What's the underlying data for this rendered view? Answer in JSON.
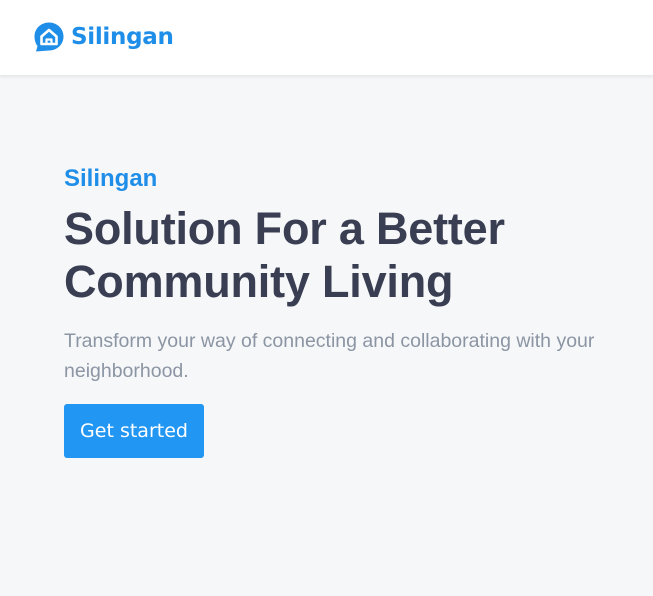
{
  "brand": {
    "name": "Silingan",
    "icon": "house-chat-bubble-icon",
    "color": "#1f8ee8"
  },
  "hero": {
    "eyebrow": "Silingan",
    "headline_line1": "Solution For a Better",
    "headline_line2": "Community Living",
    "subtitle": "Transform your way of connecting and collaborating with your neighborhood.",
    "cta_label": "Get started"
  },
  "colors": {
    "accent": "#2196f3",
    "heading": "#393e52",
    "muted": "#8b95a3",
    "background": "#f6f7f9"
  }
}
